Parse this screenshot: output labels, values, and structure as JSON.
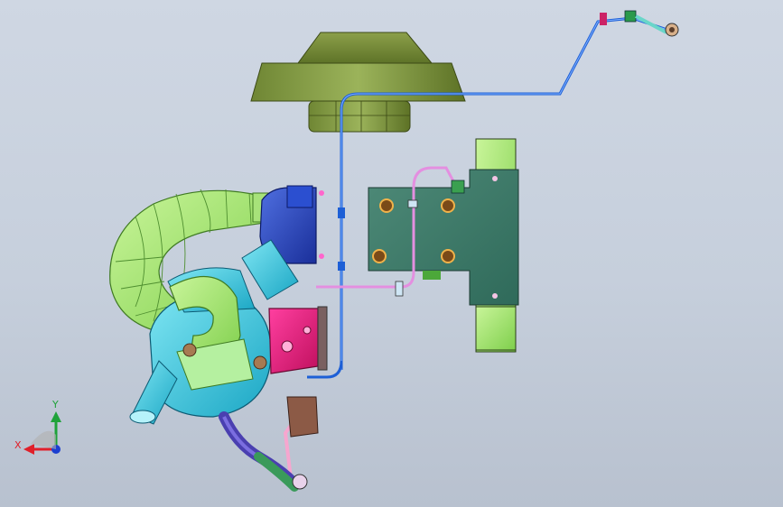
{
  "viewport": {
    "background_top": "#cfd7e3",
    "background_bottom": "#b8c1cf"
  },
  "triad": {
    "x_label": "X",
    "y_label": "Y",
    "x_color": "#e0202a",
    "y_color": "#1fa23a",
    "z_color": "#1c3fd0"
  },
  "parts": {
    "air_filter_housing": "olive-green",
    "bracket_plate": "teal-green",
    "intake_hose": "light-green",
    "turbo_compressor": "cyan",
    "actuator_can": "blue",
    "exhaust_manifold": "magenta",
    "oil_line": "pink",
    "vacuum_line": "blue"
  },
  "icons": {
    "triad": "axis-triad-icon"
  }
}
